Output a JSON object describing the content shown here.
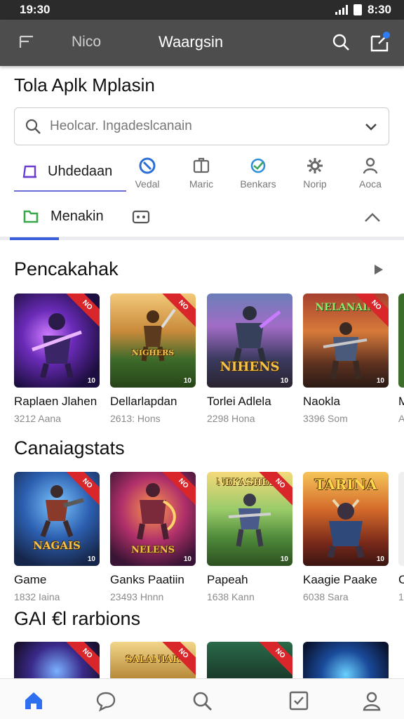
{
  "status": {
    "time": "19:30",
    "right": "8:30"
  },
  "app_bar": {
    "secondary": "Nico",
    "title": "Waargsin"
  },
  "page": {
    "title": "Tola Aplk Mplasin"
  },
  "search": {
    "placeholder": "Heolcar. Ingadeslcanain"
  },
  "categories": {
    "main": "Uhdedaan",
    "items": [
      {
        "label": "Vedal",
        "icon": "shield-icon",
        "color": "#2b6fd6"
      },
      {
        "label": "Maric",
        "icon": "case-icon",
        "color": "#666666"
      },
      {
        "label": "Benkars",
        "icon": "globe-icon",
        "color": "#2f8fd9"
      },
      {
        "label": "Norip",
        "icon": "gear-icon",
        "color": "#666666"
      },
      {
        "label": "Aoca",
        "icon": "person-icon",
        "color": "#666666"
      }
    ]
  },
  "tabs": {
    "active_label": "Menakin"
  },
  "sections": [
    {
      "title": "Pencakahak",
      "cards": [
        {
          "name": "Raplaen Jlahen",
          "meta": "3212 Aana",
          "art": "",
          "ribbon": "NO",
          "badge": "10"
        },
        {
          "name": "Dellarlapdan",
          "meta": "2613: Hons",
          "art": "NIGHERS",
          "ribbon": "NO",
          "badge": "10"
        },
        {
          "name": "Torlei Adlela",
          "meta": "2298 Hona",
          "art": "NIHENS",
          "ribbon": "",
          "badge": "10"
        },
        {
          "name": "Naokla",
          "meta": "3396 Som",
          "art": "NELANAIN",
          "ribbon": "NO",
          "badge": "10"
        },
        {
          "name": "M",
          "meta": "A",
          "art": "",
          "ribbon": "",
          "badge": ""
        }
      ]
    },
    {
      "title": "Canaiagstats",
      "cards": [
        {
          "name": "Game",
          "meta": "1832 Iaina",
          "art": "NAGAIS",
          "ribbon": "NO",
          "badge": "10"
        },
        {
          "name": "Ganks Paatiin",
          "meta": "23493 Hnnn",
          "art": "NELENS",
          "ribbon": "NO",
          "badge": "10"
        },
        {
          "name": "Papeah",
          "meta": "1638 Kann",
          "art": "NEKASHERS",
          "ribbon": "NO",
          "badge": "10"
        },
        {
          "name": "Kaagie Paake",
          "meta": "6038 Sara",
          "art": "TARINA",
          "ribbon": "",
          "badge": "10"
        },
        {
          "name": "C",
          "meta": "1",
          "art": "",
          "ribbon": "",
          "badge": ""
        }
      ]
    },
    {
      "title": "GAI €l rarbions",
      "cards": [
        {
          "name": "",
          "meta": "",
          "art": "",
          "ribbon": "NO",
          "badge": ""
        },
        {
          "name": "",
          "meta": "",
          "art": "SALANIAR",
          "ribbon": "NO",
          "badge": ""
        },
        {
          "name": "",
          "meta": "",
          "art": "",
          "ribbon": "NO",
          "badge": ""
        },
        {
          "name": "",
          "meta": "",
          "art": "",
          "ribbon": "",
          "badge": ""
        }
      ]
    }
  ],
  "bottom_nav": {
    "items": [
      {
        "icon": "home-icon",
        "active": true
      },
      {
        "icon": "chat-icon",
        "active": false
      },
      {
        "icon": "search-icon",
        "active": false
      },
      {
        "icon": "checkbox-icon",
        "active": false
      },
      {
        "icon": "profile-icon",
        "active": false
      }
    ]
  },
  "colors": {
    "accent": "#3b5fd9",
    "app_bar": "#4d4d4d",
    "ribbon": "#d8262b"
  }
}
